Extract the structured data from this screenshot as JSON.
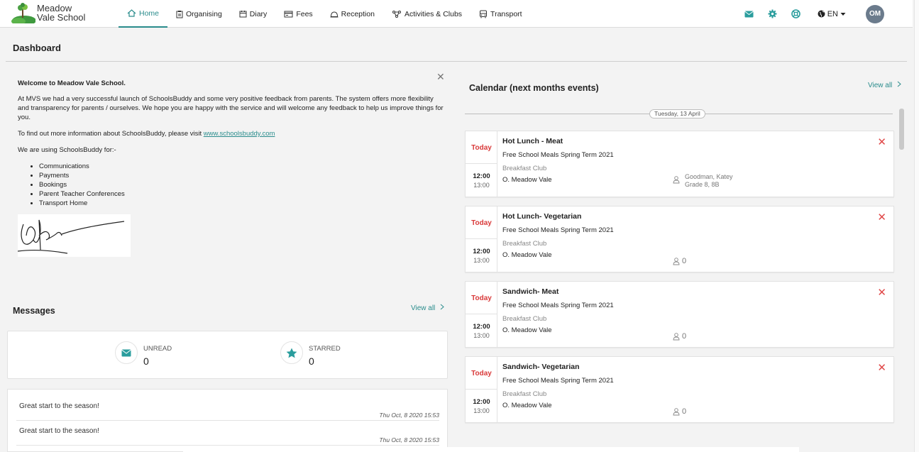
{
  "header": {
    "logo_line1": "Meadow",
    "logo_line2": "Vale School",
    "nav": [
      {
        "label": "Home",
        "icon": "home-icon"
      },
      {
        "label": "Organising",
        "icon": "clipboard-icon"
      },
      {
        "label": "Diary",
        "icon": "calendar-icon"
      },
      {
        "label": "Fees",
        "icon": "card-icon"
      },
      {
        "label": "Reception",
        "icon": "bell-icon"
      },
      {
        "label": "Activities & Clubs",
        "icon": "network-icon"
      },
      {
        "label": "Transport",
        "icon": "bus-icon"
      }
    ],
    "language": "EN",
    "avatar_initials": "OM",
    "accent_color": "#2a8c8c"
  },
  "dashboard": {
    "title": "Dashboard"
  },
  "welcome": {
    "title": "Welcome to Meadow Vale School.",
    "para1": "At MVS we had a very successful launch of SchoolsBuddy and some very positive feedback from parents. The system offers more flexibility and transparency for parents / ourselves. We hope you are happy with the service and will welcome any feedback to help us improve things for you.",
    "para2_prefix": "To find out more information about SchoolsBuddy, please visit ",
    "link": "www.schoolsbuddy.com",
    "para3": "We are using SchoolsBuddy for:-",
    "items": [
      "Communications",
      "Payments",
      "Bookings",
      "Parent Teacher Conferences",
      "Transport Home"
    ]
  },
  "messages": {
    "title": "Messages",
    "view_all": "View all",
    "unread_label": "UNREAD",
    "unread_count": "0",
    "starred_label": "STARRED",
    "starred_count": "0",
    "list": [
      {
        "title": "Great start to the season!",
        "date": "Thu Oct, 8 2020 15:53"
      },
      {
        "title": "Great start to the season!",
        "date": "Thu Oct, 8 2020 15:53"
      }
    ]
  },
  "calendar": {
    "title": "Calendar (next months events)",
    "view_all": "View all",
    "date_label": "Tuesday, 13 April",
    "events": [
      {
        "day": "Today",
        "start": "12:00",
        "end": "13:00",
        "title": "Hot Lunch - Meat",
        "subtitle": "Free School Meals Spring Term 2021",
        "category": "Breakfast Club",
        "location": "O. Meadow Vale",
        "person": "Goodman, Katey",
        "grade": "Grade 8, 8B"
      },
      {
        "day": "Today",
        "start": "12:00",
        "end": "13:00",
        "title": "Hot Lunch- Vegetarian",
        "subtitle": "Free School Meals Spring Term 2021",
        "category": "Breakfast Club",
        "location": "O. Meadow Vale",
        "count": "0"
      },
      {
        "day": "Today",
        "start": "12:00",
        "end": "13:00",
        "title": "Sandwich- Meat",
        "subtitle": "Free School Meals Spring Term 2021",
        "category": "Breakfast Club",
        "location": "O. Meadow Vale",
        "count": "0"
      },
      {
        "day": "Today",
        "start": "12:00",
        "end": "13:00",
        "title": "Sandwich- Vegetarian",
        "subtitle": "Free School Meals Spring Term 2021",
        "category": "Breakfast Club",
        "location": "O. Meadow Vale",
        "count": "0"
      }
    ]
  }
}
